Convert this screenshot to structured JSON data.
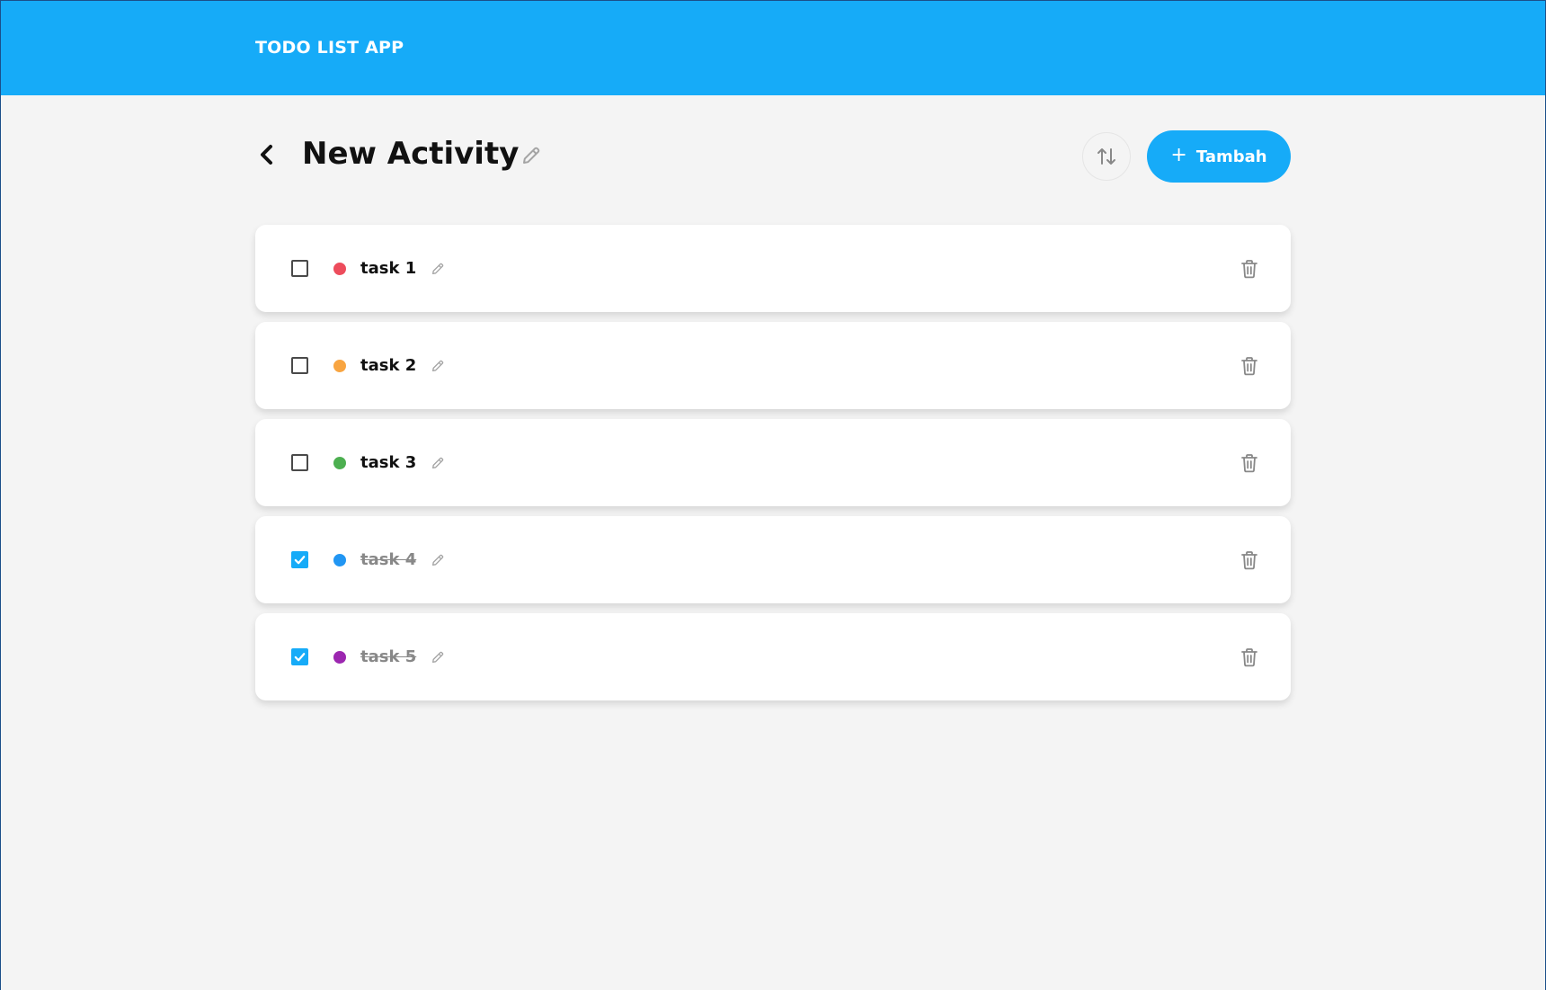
{
  "header": {
    "title": "TODO LIST APP",
    "color": "#16abf8"
  },
  "activity": {
    "title": "New Activity",
    "back_icon": "chevron-left-icon",
    "edit_icon": "pencil-icon",
    "sort_icon": "sort-arrows-icon",
    "add_button": {
      "icon": "+",
      "label": "Tambah"
    }
  },
  "items": [
    {
      "label": "task 1",
      "checked": false,
      "priority_color": "#ed4c5c"
    },
    {
      "label": "task 2",
      "checked": false,
      "priority_color": "#f8a541"
    },
    {
      "label": "task 3",
      "checked": false,
      "priority_color": "#4caf50"
    },
    {
      "label": "task 4",
      "checked": true,
      "priority_color": "#2196f3"
    },
    {
      "label": "task 5",
      "checked": true,
      "priority_color": "#9c27b0"
    }
  ]
}
